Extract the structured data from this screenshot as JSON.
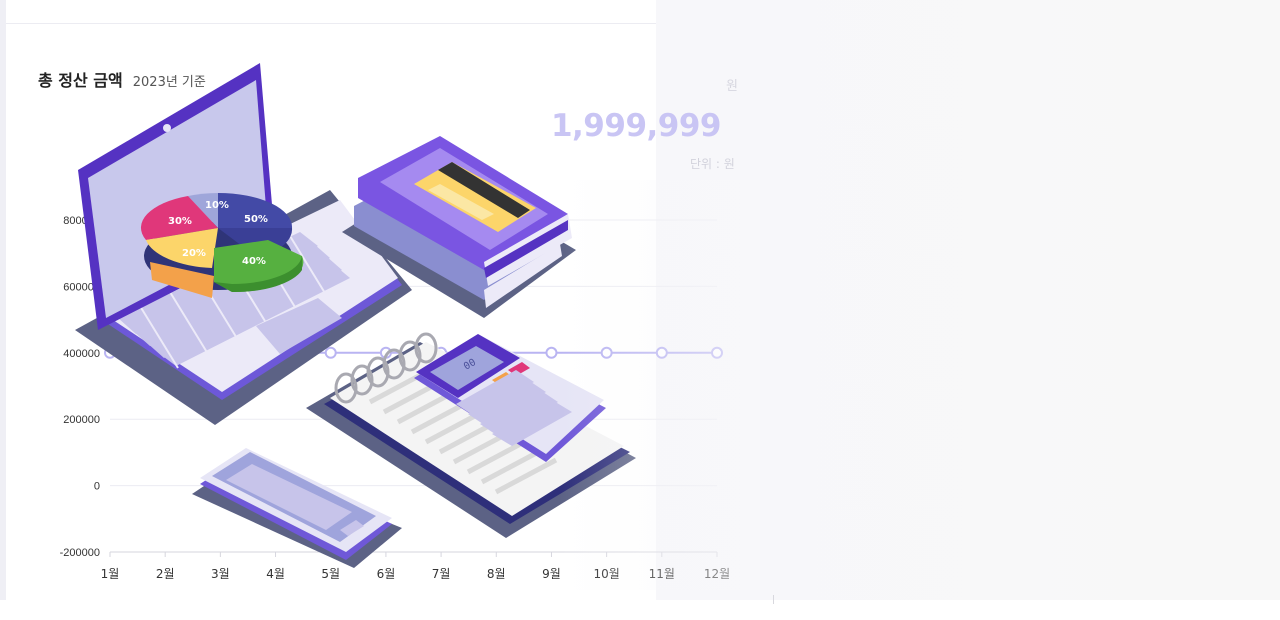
{
  "header": {
    "title": "총 정산 금액",
    "subtitle": "2023년 기준",
    "unit_top": "원",
    "total_value": "1,999,999",
    "unit_label": "단위 : 원"
  },
  "chart_data": {
    "type": "line",
    "title": "총 정산 금액",
    "subtitle": "2023년 기준",
    "x": [
      "1월",
      "2월",
      "3월",
      "4월",
      "5월",
      "6월",
      "7월",
      "8월",
      "9월",
      "10월",
      "11월",
      "12월"
    ],
    "y_ticks": [
      -200000,
      0,
      200000,
      400000,
      600000,
      800000
    ],
    "y_tick_labels": [
      "-200000",
      "0",
      "200000",
      "400000",
      "600000",
      "800000"
    ],
    "ylim": [
      -200000,
      800000
    ],
    "series": [
      {
        "values": [
          400000,
          400000,
          400000,
          400000,
          400000,
          400000,
          400000,
          400000,
          400000,
          400000,
          400000,
          400000
        ]
      }
    ],
    "grid": true,
    "line_color": "#b9b4f2"
  },
  "illustration": {
    "pie_labels": [
      "50%",
      "40%",
      "30%",
      "20%",
      "10%"
    ],
    "calculator_display": "00",
    "colors": {
      "purple": "#6a4fd6",
      "lavender": "#c9c6ec",
      "pink": "#e0377a",
      "yellow": "#fcd56a",
      "green": "#56b040",
      "navy": "#434aa6",
      "shadow": "#5c6285"
    }
  }
}
